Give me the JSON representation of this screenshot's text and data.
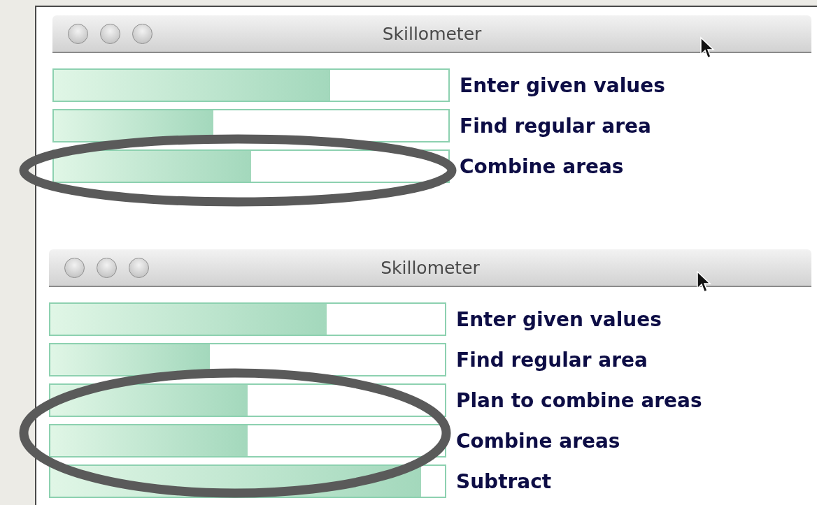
{
  "windows": [
    {
      "title": "Skillometer",
      "skills": [
        {
          "name": "Enter given values",
          "level": 0.7
        },
        {
          "name": "Find regular area",
          "level": 0.405
        },
        {
          "name": "Combine areas",
          "level": 0.5
        }
      ]
    },
    {
      "title": "Skillometer",
      "skills": [
        {
          "name": "Enter given values",
          "level": 0.7
        },
        {
          "name": "Find regular area",
          "level": 0.405
        },
        {
          "name": "Plan to combine areas",
          "level": 0.5
        },
        {
          "name": "Combine areas",
          "level": 0.5
        },
        {
          "name": "Subtract",
          "level": 0.94
        }
      ]
    }
  ]
}
